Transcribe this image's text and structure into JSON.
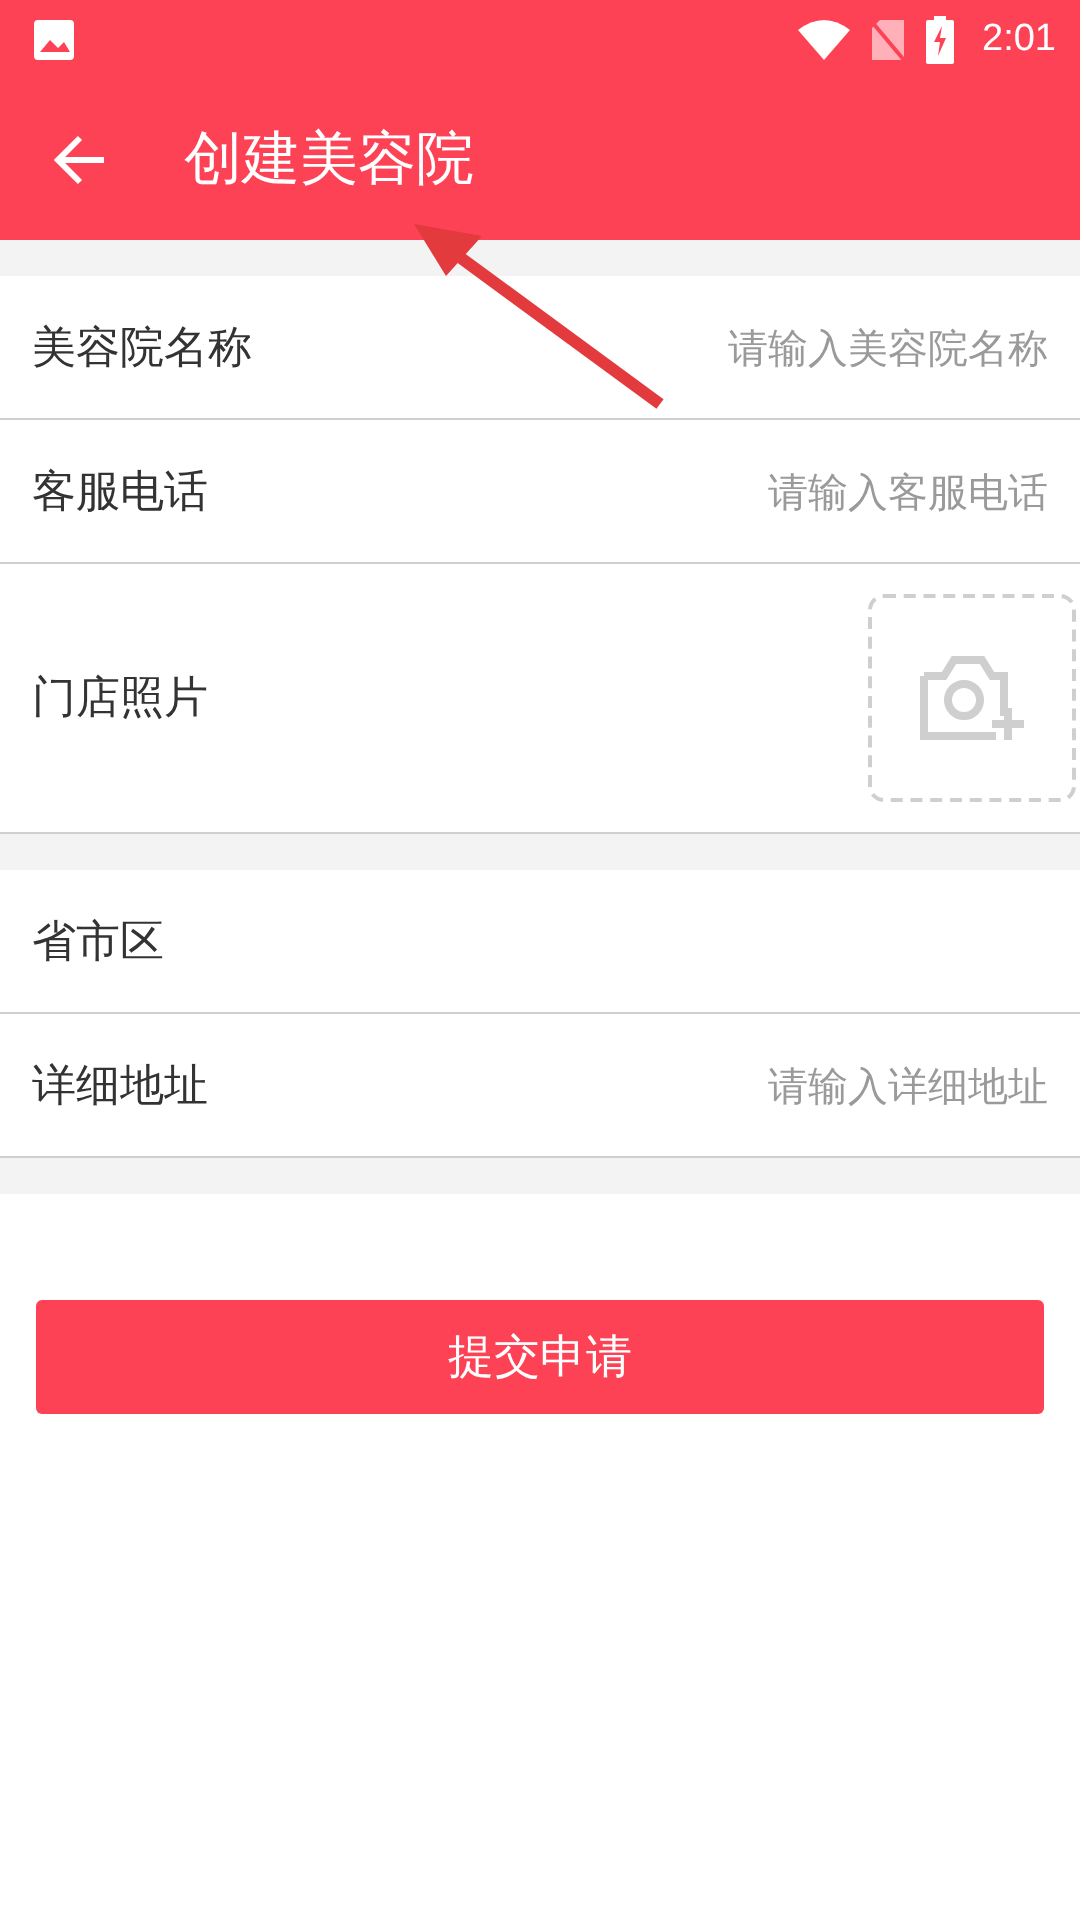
{
  "status_bar": {
    "time": "2:01"
  },
  "header": {
    "title": "创建美容院"
  },
  "sections": [
    {
      "fields": [
        {
          "kind": "text",
          "label": "美容院名称",
          "placeholder": "请输入美容院名称"
        },
        {
          "kind": "text",
          "label": "客服电话",
          "placeholder": "请输入客服电话"
        },
        {
          "kind": "photo",
          "label": "门店照片"
        }
      ]
    },
    {
      "fields": [
        {
          "kind": "select",
          "label": "省市区"
        },
        {
          "kind": "text",
          "label": "详细地址",
          "placeholder": "请输入详细地址"
        }
      ]
    }
  ],
  "submit_button": "提交申请"
}
